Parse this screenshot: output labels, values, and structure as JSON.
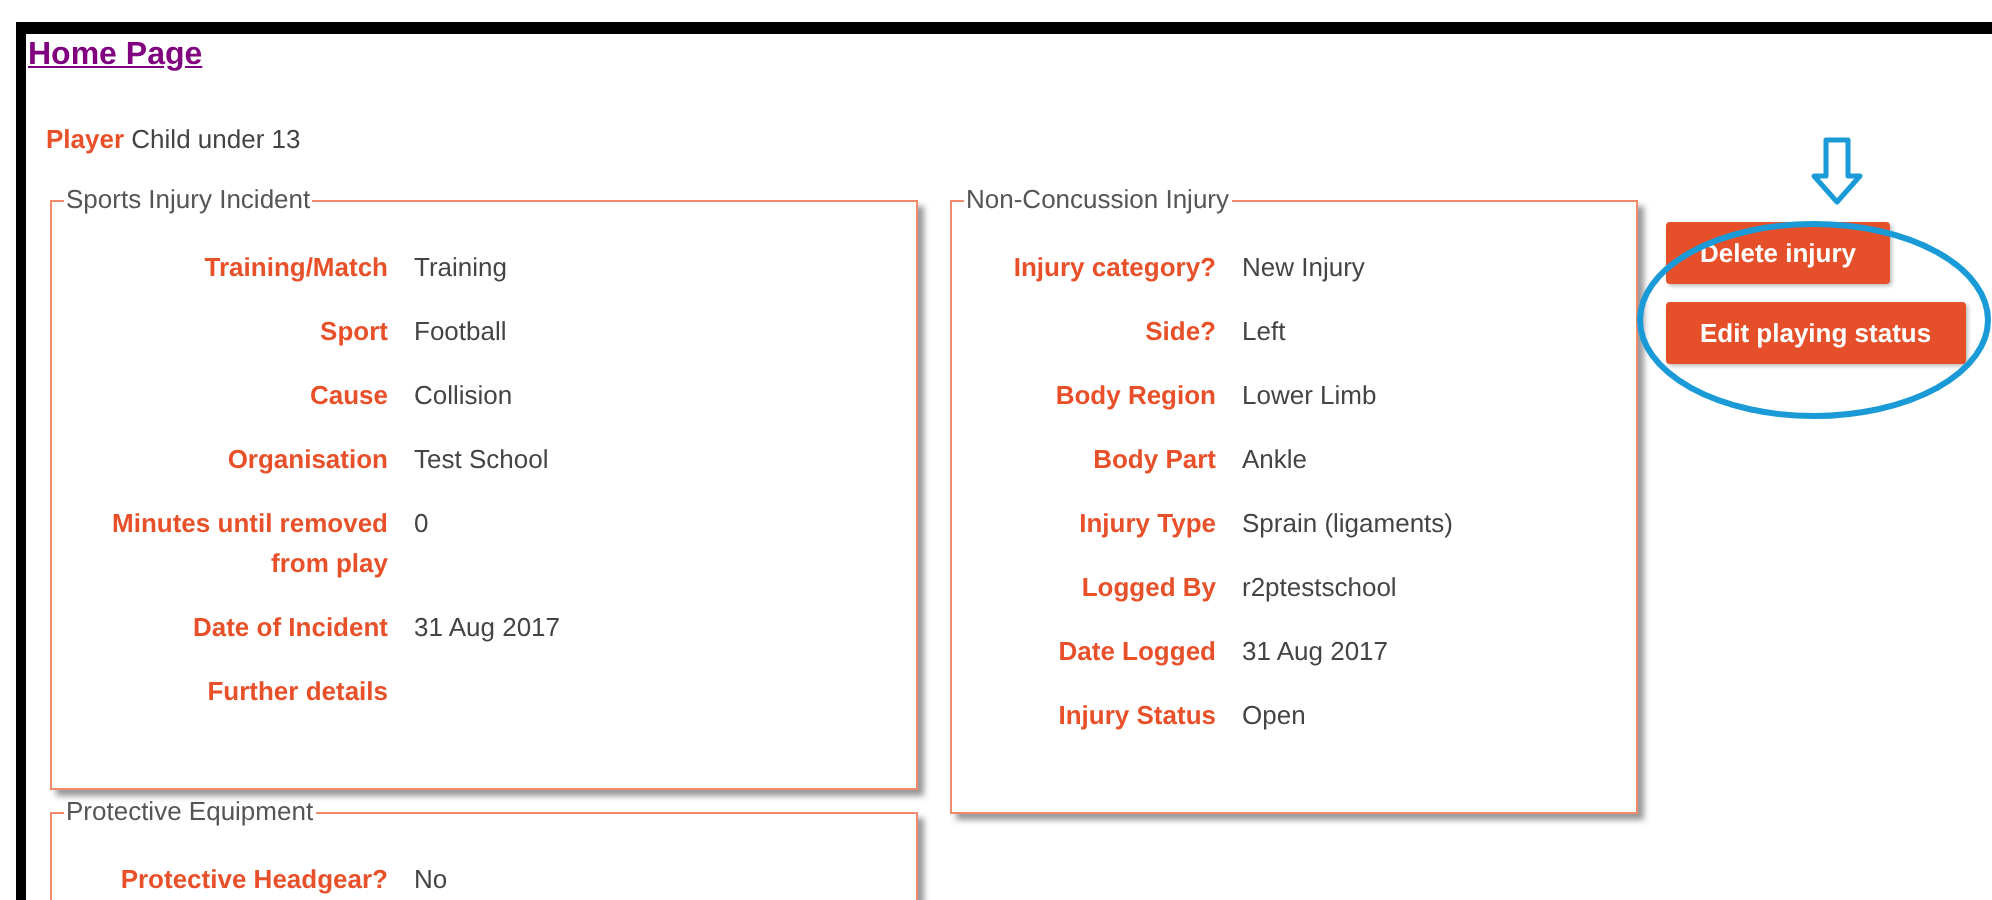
{
  "home_link": "Home Page",
  "player": {
    "label": "Player",
    "value": "Child under 13"
  },
  "panels": [
    {
      "title": "Sports Injury Incident",
      "rows": [
        {
          "label": "Training/Match",
          "value": "Training"
        },
        {
          "label": "Sport",
          "value": "Football"
        },
        {
          "label": "Cause",
          "value": "Collision"
        },
        {
          "label": "Organisation",
          "value": "Test School"
        },
        {
          "label": "Minutes until removed from play",
          "value": "0"
        },
        {
          "label": "Date of Incident",
          "value": "31 Aug 2017"
        },
        {
          "label": "Further details"
        }
      ]
    },
    {
      "title": "Non-Concussion Injury",
      "rows": [
        {
          "label": "Injury category?",
          "value": "New Injury"
        },
        {
          "label": "Side?",
          "value": "Left"
        },
        {
          "label": "Body Region",
          "value": "Lower Limb"
        },
        {
          "label": "Body Part",
          "value": "Ankle"
        },
        {
          "label": "Injury Type",
          "value": "Sprain (ligaments)"
        },
        {
          "label": "Logged By",
          "value": "r2ptestschool"
        },
        {
          "label": "Date Logged",
          "value": "31 Aug 2017"
        },
        {
          "label": "Injury Status",
          "value": "Open"
        }
      ]
    },
    {
      "title": "Protective Equipment",
      "rows": [
        {
          "label": "Protective Headgear?",
          "value": "No"
        }
      ]
    }
  ],
  "buttons": [
    "Delete injury",
    "Edit playing status"
  ]
}
